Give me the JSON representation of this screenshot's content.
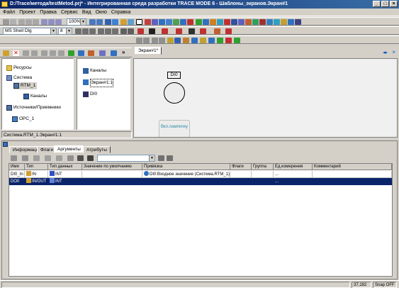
{
  "window": {
    "title": "D:/Trace/метода/testMetod.prj* - Интегрированная среда разработки TRACE MODE 6 - Шаблоны_экранов.Экран#1"
  },
  "menu": [
    "Файл",
    "Проект",
    "Правка",
    "Сервис",
    "Вид",
    "Окно",
    "Справка"
  ],
  "toolbar": {
    "zoom": "100%",
    "font": "MS Shell Dlg",
    "font_size": "8"
  },
  "tree": {
    "items": [
      {
        "label": "Ресурсы",
        "icon": "folder-icon"
      },
      {
        "label": "Система",
        "icon": "system-icon"
      },
      {
        "label": "RTM_1",
        "icon": "computer-icon"
      },
      {
        "label": "Каналы",
        "icon": "channels-icon"
      },
      {
        "label": "Источники/Приемники",
        "icon": "source-icon"
      },
      {
        "label": "OPC_1",
        "icon": "opc-icon"
      }
    ],
    "status": "Система.RTM_1.Экран#1:1"
  },
  "channels": {
    "items": [
      {
        "label": "Каналы",
        "icon": "channels-icon"
      },
      {
        "label": "Экран#1:1",
        "icon": "screen-icon"
      },
      {
        "label": "DI0",
        "icon": "di-icon"
      }
    ]
  },
  "editor": {
    "tab": "Экран#1*",
    "label_di": "DI0",
    "button_text": "Вкл.лампочку"
  },
  "bottom": {
    "tabs": [
      "Информация",
      "Флаги",
      "Аргументы",
      "Атрибуты"
    ],
    "active_tab": 2,
    "columns": [
      "Имя",
      "Тип",
      "Тип данных",
      "Значение по умолчанию",
      "Привязка",
      "Флаги",
      "Группа",
      "Ед.измерения",
      "Комментарий"
    ],
    "rows": [
      {
        "name": "DI0_In",
        "type": "IN",
        "dtype": "INT",
        "default": "",
        "binding": "DI0:Входное значение (Система.RTM_1)",
        "flags": "",
        "group": "",
        "unit": "...",
        "comment": ""
      },
      {
        "name": "DO0",
        "type": "IN/OUT",
        "dtype": "INT",
        "default": "",
        "binding": "",
        "flags": "",
        "group": "",
        "unit": "...",
        "comment": ""
      }
    ]
  },
  "status": {
    "coords": "37,182",
    "snap": "Snap OFF"
  },
  "colors": {
    "title_start": "#0a246a",
    "title_end": "#3a6ea5",
    "selection": "#0a246a",
    "canvas": "#f0f0f0"
  }
}
